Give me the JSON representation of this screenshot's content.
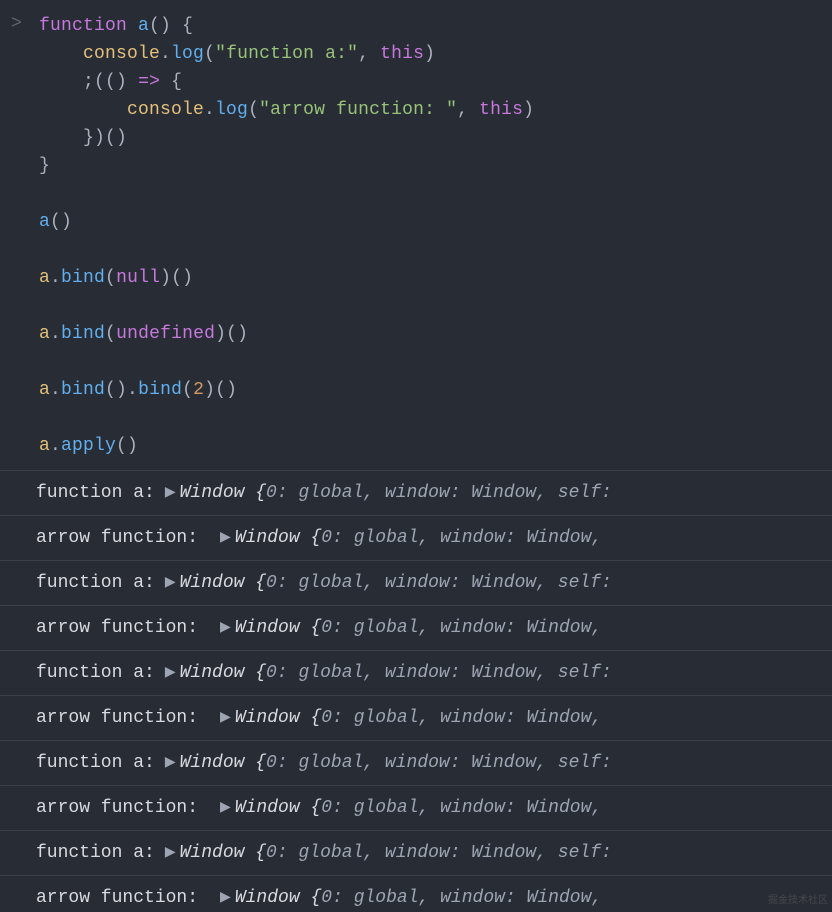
{
  "prompt": ">",
  "code": {
    "l1_fn": "function",
    "l1_name": "a",
    "l1_open": "()",
    "l1_brace": "{",
    "l2_obj": "console",
    "l2_dot": ".",
    "l2_method": "log",
    "l2_open": "(",
    "l2_str": "\"function a:\"",
    "l2_comma": ",",
    "l2_this": "this",
    "l2_close": ")",
    "l3_lead": ";((",
    "l3_paren_close": ")",
    "l3_arrow": "=>",
    "l3_brace": "{",
    "l4_obj": "console",
    "l4_dot": ".",
    "l4_method": "log",
    "l4_open": "(",
    "l4_str": "\"arrow function: \"",
    "l4_comma": ",",
    "l4_this": "this",
    "l4_close": ")",
    "l5": "})()",
    "l6": "}",
    "l8_name": "a",
    "l8_call": "()",
    "l10_name": "a",
    "l10_dot": ".",
    "l10_bind": "bind",
    "l10_open": "(",
    "l10_null": "null",
    "l10_close": ")()",
    "l12_name": "a",
    "l12_dot": ".",
    "l12_bind": "bind",
    "l12_open": "(",
    "l12_undef": "undefined",
    "l12_close": ")()",
    "l14_name": "a",
    "l14_dot": ".",
    "l14_bind1": "bind",
    "l14_mid": "().",
    "l14_bind2": "bind",
    "l14_open": "(",
    "l14_two": "2",
    "l14_close": ")()",
    "l16_name": "a",
    "l16_dot": ".",
    "l16_apply": "apply",
    "l16_call": "()"
  },
  "log": {
    "label_fn": "function a:",
    "label_arrow": "arrow function: ",
    "expander": "▶",
    "cls": "Window",
    "open": "{",
    "k0": "0",
    "v0": "global",
    "k1": "window",
    "v1": "Window",
    "k2": "self",
    "colon": ":",
    "comma": ",",
    "tail_self": "self:",
    "tail_comma": ","
  },
  "watermark": "掘金技术社区"
}
